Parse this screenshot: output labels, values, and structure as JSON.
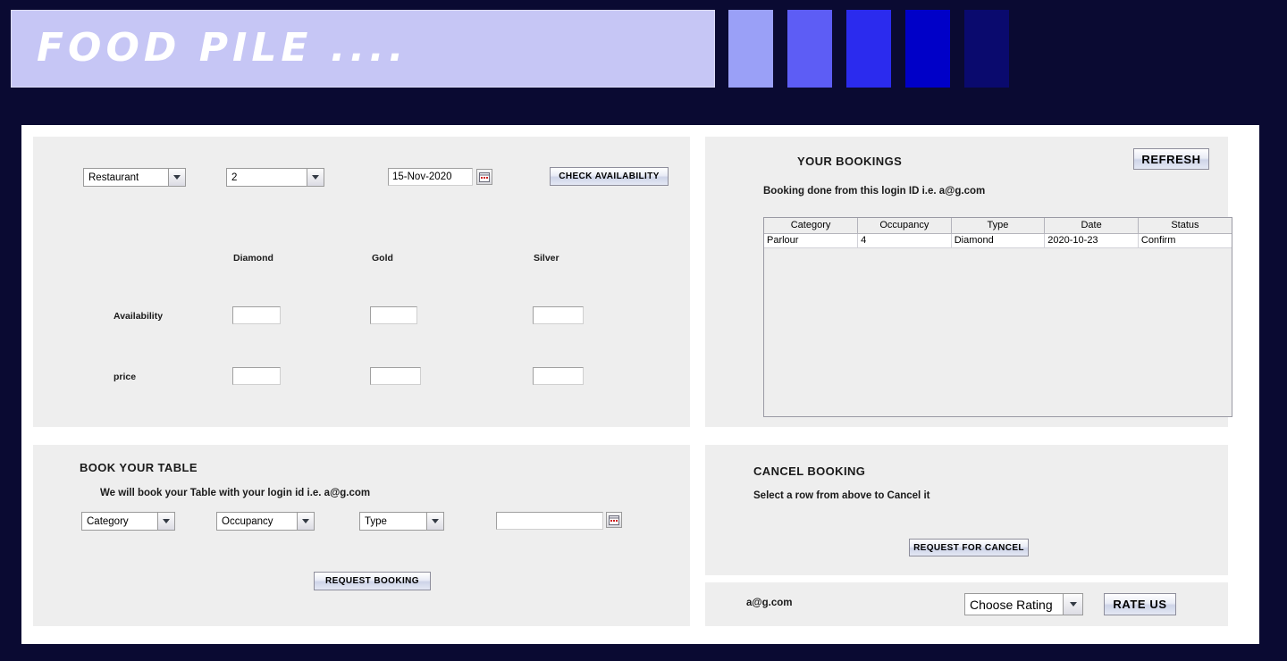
{
  "header": {
    "brand": "FOOD PILE ....",
    "swatch_colors": [
      "#9aa0f7",
      "#5d5df5",
      "#2b2bee",
      "#0000c8",
      "#0a0a6e"
    ]
  },
  "availability_panel": {
    "restaurant_select": "Restaurant",
    "occupancy_select": "2",
    "date_value": "15-Nov-2020",
    "calendar_icon": "calendar-icon",
    "check_button": "CHECK AVAILABILITY",
    "columns": [
      "Diamond",
      "Gold",
      "Silver"
    ],
    "rows": [
      {
        "label": "Availability",
        "values": [
          "",
          "",
          ""
        ]
      },
      {
        "label": "price",
        "values": [
          "",
          "",
          ""
        ]
      }
    ]
  },
  "bookings_panel": {
    "title": "YOUR BOOKINGS",
    "refresh_button": "REFRESH",
    "login_note": "Booking done from this login ID i.e.  a@g.com",
    "table": {
      "headers": [
        "Category",
        "Occupancy",
        "Type",
        "Date",
        "Status"
      ],
      "rows": [
        [
          "Parlour",
          "4",
          "Diamond",
          "2020-10-23",
          "Confirm"
        ]
      ]
    }
  },
  "book_panel": {
    "title": "BOOK YOUR TABLE",
    "note": "We will book your Table with your login id i.e.   a@g.com",
    "category_select": "Category",
    "occupancy_select": "Occupancy",
    "type_select": "Type",
    "date_value": "",
    "calendar_icon": "calendar-icon",
    "request_button": "REQUEST BOOKING"
  },
  "cancel_panel": {
    "title": "CANCEL BOOKING",
    "note": "Select a row from above to Cancel it",
    "cancel_button": "REQUEST FOR CANCEL"
  },
  "rate_panel": {
    "email": "a@g.com",
    "rating_select": "Choose Rating",
    "rate_button": "RATE US"
  }
}
